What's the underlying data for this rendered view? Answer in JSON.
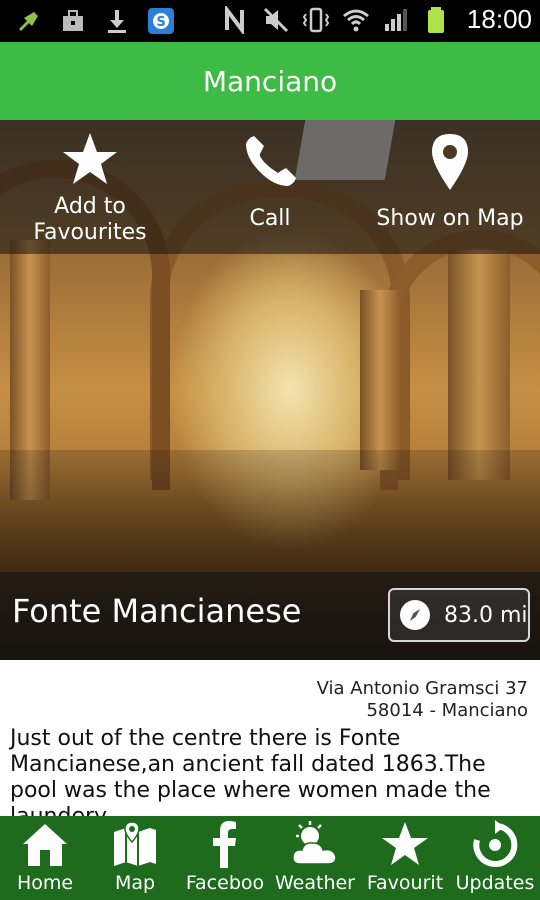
{
  "status_bar": {
    "time": "18:00",
    "icons": [
      "usb-debug-icon",
      "bag-icon",
      "download-icon",
      "skype-icon",
      "nfc-icon",
      "mute-icon",
      "vibrate-icon",
      "wifi-icon",
      "signal-icon",
      "battery-icon"
    ]
  },
  "header": {
    "title": "Manciano"
  },
  "actions": [
    {
      "label": "Add to\nFavourites",
      "icon": "star-icon"
    },
    {
      "label": "Call",
      "icon": "phone-icon"
    },
    {
      "label": "Show on Map",
      "icon": "map-pin-icon"
    }
  ],
  "place": {
    "name": "Fonte Mancianese",
    "distance": "83.0 mi"
  },
  "content": {
    "address_line1": "Via Antonio Gramsci 37",
    "address_line2": "58014 - Manciano",
    "description": "Just out of the centre there is Fonte Mancianese,an ancient fall dated 1863.The pool was the place where women made the laundery"
  },
  "bottom_nav": [
    {
      "label": "Home",
      "icon": "home-icon"
    },
    {
      "label": "Map",
      "icon": "map-icon"
    },
    {
      "label": "Faceboo",
      "icon": "facebook-icon"
    },
    {
      "label": "Weather",
      "icon": "weather-icon"
    },
    {
      "label": "Favourit",
      "icon": "star-icon"
    },
    {
      "label": "Updates",
      "icon": "refresh-icon"
    }
  ],
  "colors": {
    "header": "#3dbb44",
    "bottom_nav": "#1e6b1e"
  }
}
